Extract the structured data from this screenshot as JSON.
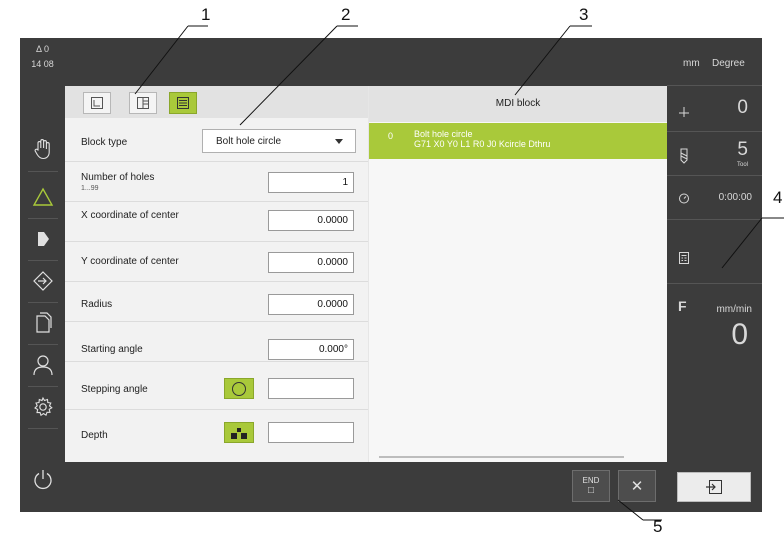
{
  "callouts": [
    "1",
    "2",
    "3",
    "4",
    "5"
  ],
  "status_bar": {
    "position_indicator": "Δ 0",
    "time": "14 08"
  },
  "left_nav": {
    "items": [
      "manual-operation",
      "mdi",
      "program-run",
      "setup",
      "file-management",
      "user-login",
      "settings",
      "power"
    ]
  },
  "form": {
    "rows": [
      {
        "label": "Block type",
        "value": "Bolt hole circle"
      },
      {
        "label": "Number of holes",
        "hint": "1...99",
        "value": "1"
      },
      {
        "label": "X coordinate of center",
        "value": "0.0000"
      },
      {
        "label": "Y coordinate of center",
        "value": "0.0000"
      },
      {
        "label": "Radius",
        "value": "0.0000"
      },
      {
        "label": "Starting angle",
        "value": "0.000°"
      },
      {
        "label": "Stepping angle",
        "value": ""
      },
      {
        "label": "Depth",
        "value": ""
      }
    ]
  },
  "mdi": {
    "header": "MDI block",
    "entry_number": "0",
    "entry_line1": "Bolt hole circle",
    "entry_line2": "G71 X0 Y0 L1 R0 J0 Kcircle Dthru"
  },
  "bottom": {
    "end_label": "END",
    "end_glyph": "□",
    "close_glyph": "✕"
  },
  "status_panel": {
    "unit_length": "mm",
    "unit_angle": "Degree",
    "ref_value": "0",
    "tool_value": "5",
    "tool_label": "Tool",
    "timer": "0:00:00",
    "feed_letter": "F",
    "feed_unit": "mm/min",
    "feed_value": "0"
  },
  "colors": {
    "accent": "#a9c93a",
    "dark": "#3c3c3c"
  }
}
